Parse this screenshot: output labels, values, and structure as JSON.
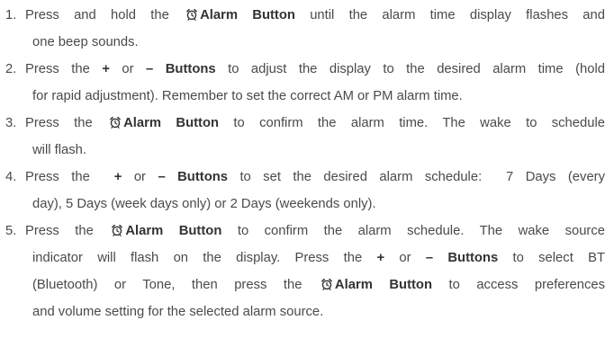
{
  "steps": [
    {
      "number": "1.",
      "lines": [
        {
          "parts": [
            {
              "t": "Press and hold the "
            },
            {
              "icon": "alarm-clock-icon"
            },
            {
              "b": "Alarm Button"
            },
            {
              "t": " until the alarm time display flashes and"
            }
          ]
        },
        {
          "parts": [
            {
              "t": "one beep sounds."
            }
          ]
        }
      ]
    },
    {
      "number": "2.",
      "lines": [
        {
          "parts": [
            {
              "t": "Press the "
            },
            {
              "b": "+"
            },
            {
              "t": " or "
            },
            {
              "b": "– Buttons"
            },
            {
              "t": " to adjust the display to the desired alarm time (hold"
            }
          ]
        },
        {
          "parts": [
            {
              "t": "for rapid adjustment). Remember to set the correct AM or PM alarm time."
            }
          ]
        }
      ]
    },
    {
      "number": "3.",
      "lines": [
        {
          "parts": [
            {
              "t": "Press the "
            },
            {
              "icon": "alarm-clock-icon"
            },
            {
              "b": "Alarm Button"
            },
            {
              "t": " to confirm the alarm time. The wake to schedule"
            }
          ]
        },
        {
          "parts": [
            {
              "t": "will flash."
            }
          ]
        }
      ]
    },
    {
      "number": "4.",
      "lines": [
        {
          "parts": [
            {
              "t": "Press the  "
            },
            {
              "b": "+"
            },
            {
              "t": " or "
            },
            {
              "b": "– Buttons"
            },
            {
              "t": " to set the desired alarm schedule:  7 Days (every"
            }
          ]
        },
        {
          "parts": [
            {
              "t": "day), 5 Days (week days only) or 2 Days (weekends only)."
            }
          ]
        }
      ]
    },
    {
      "number": "5.",
      "lines": [
        {
          "parts": [
            {
              "t": "Press the "
            },
            {
              "icon": "alarm-clock-icon"
            },
            {
              "b": "Alarm Button"
            },
            {
              "t": " to confirm the alarm schedule. The wake source"
            }
          ]
        },
        {
          "parts": [
            {
              "t": "indicator will flash on the display. Press the "
            },
            {
              "b": "+"
            },
            {
              "t": " or "
            },
            {
              "b": "– Buttons"
            },
            {
              "t": " to select BT"
            }
          ]
        },
        {
          "parts": [
            {
              "t": "(Bluetooth) or Tone, then press the "
            },
            {
              "icon": "alarm-clock-icon"
            },
            {
              "b": "Alarm Button"
            },
            {
              "t": " to access preferences"
            }
          ]
        },
        {
          "parts": [
            {
              "t": "and volume setting for the selected alarm source."
            }
          ]
        }
      ]
    }
  ]
}
